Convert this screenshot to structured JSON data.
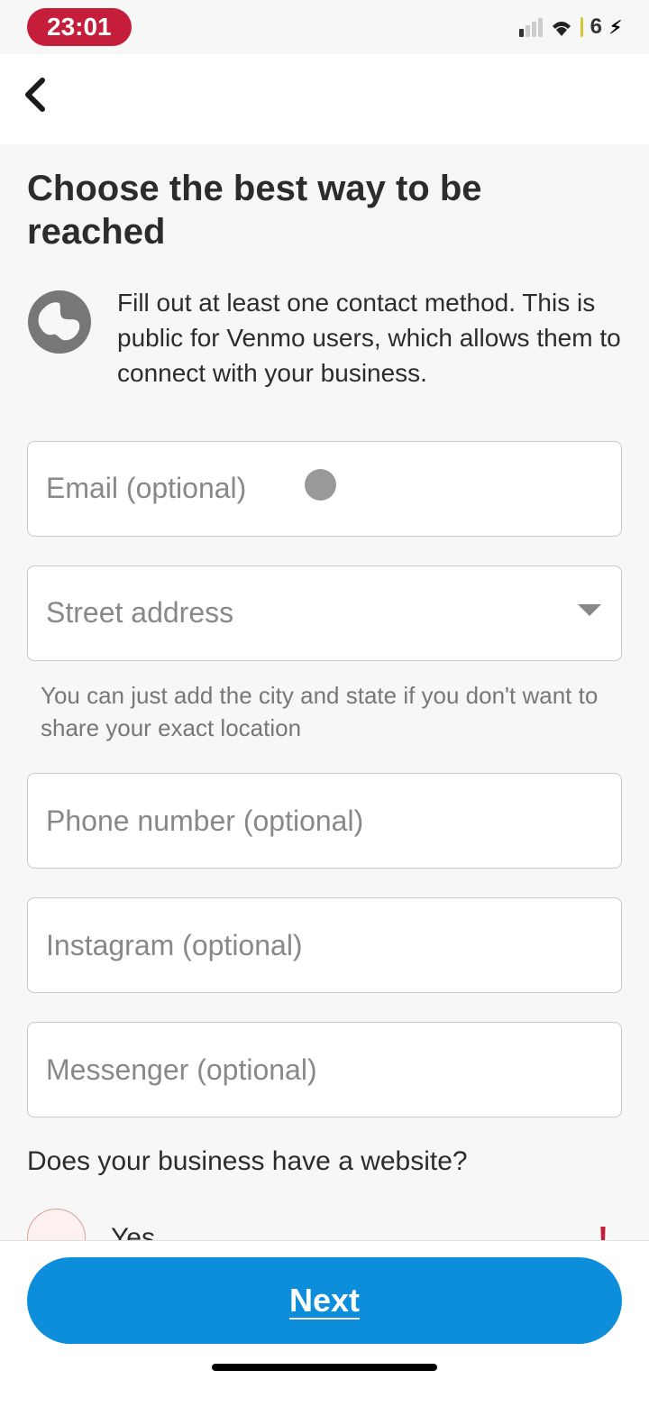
{
  "statusBar": {
    "time": "23:01",
    "battery": "6"
  },
  "page": {
    "title": "Choose the best way to be reached",
    "infoText": "Fill out at least one contact method. This is public for Venmo users, which allows them to connect with your business."
  },
  "fields": {
    "email": {
      "placeholder": "Email (optional)"
    },
    "address": {
      "placeholder": "Street address",
      "helper": "You can just add the city and state if you don't want to share your exact location"
    },
    "phone": {
      "placeholder": "Phone number (optional)"
    },
    "instagram": {
      "placeholder": "Instagram (optional)"
    },
    "messenger": {
      "placeholder": "Messenger (optional)"
    }
  },
  "websiteSection": {
    "question": "Does your business have a website?",
    "yesLabel": "Yes"
  },
  "footer": {
    "nextLabel": "Next"
  }
}
